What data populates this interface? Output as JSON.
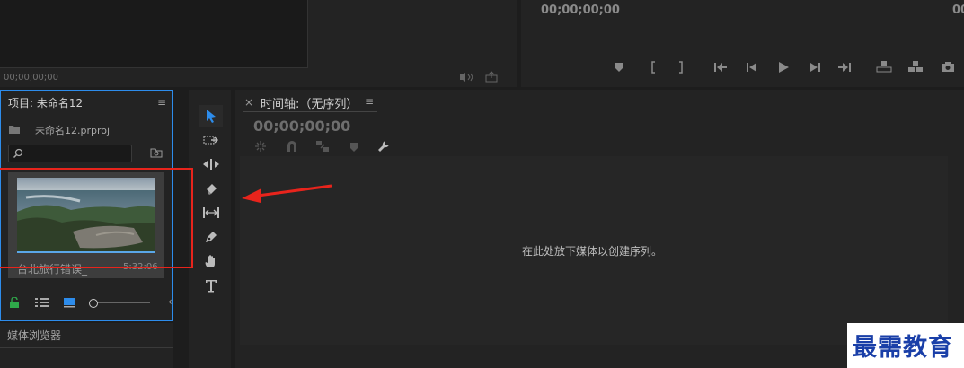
{
  "source_monitor": {
    "timecode": "00;00;00;00"
  },
  "program_monitor": {
    "timecode": "00;00;00;00",
    "timecode_right": "00"
  },
  "project_panel": {
    "title": "项目: 未命名12",
    "file_name": "未命名12.prproj",
    "search_placeholder": "",
    "clip": {
      "name": "台北旅行错误_",
      "duration": "5:32:06"
    }
  },
  "media_browser": {
    "title": "媒体浏览器"
  },
  "timeline": {
    "close_label": "×",
    "title": "时间轴:（无序列）",
    "timecode": "00;00;00;00",
    "drop_hint": "在此处放下媒体以创建序列。"
  },
  "watermark": {
    "text": "最需教育"
  },
  "colors": {
    "selected_tool": "#2d8ceb",
    "highlight_box": "#e8241c",
    "accent_blue": "#2d8ceb",
    "watermark": "#1a3fa8"
  }
}
